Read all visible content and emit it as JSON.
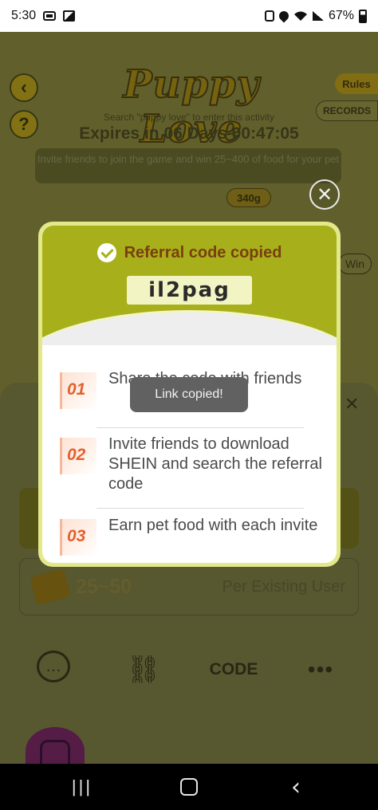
{
  "status_bar": {
    "time": "5:30",
    "battery": "67%",
    "icons": [
      "cast-icon",
      "photo-icon",
      "lock-icon",
      "location-icon",
      "wifi-icon",
      "signal-icon",
      "battery-icon"
    ]
  },
  "background": {
    "title": "Puppy Love",
    "search_hint": "Search \"puppy love\" to enter this activity",
    "expires": "Expires in 06 Days 00:47:05",
    "invite_text": "Invite friends to join the game and win 25~400 of food for your pet",
    "rules_label": "Rules",
    "records_label": "RECORDS",
    "food_badge": "340g",
    "win_label": "Win",
    "existing_range": "25~50",
    "existing_label": "Per Existing User",
    "code_label": "CODE",
    "more_label": "•••"
  },
  "modal": {
    "title": "Referral code copied",
    "code": "il2pag",
    "steps": [
      {
        "num": "01",
        "text": "Share the code with friends"
      },
      {
        "num": "02",
        "text": "Invite friends to download SHEIN and search the referral code"
      },
      {
        "num": "03",
        "text": "Earn pet food with each invite"
      }
    ],
    "close_symbol": "✕"
  },
  "toast": {
    "text": "Link copied!"
  },
  "nav_bar": {
    "recent_symbol": "|||",
    "back_symbol": "‹"
  },
  "colors": {
    "modal_header": "#a7b01a",
    "modal_title": "#7a3e10",
    "step_number": "#e4602c",
    "code_box": "#f3f4c3"
  }
}
